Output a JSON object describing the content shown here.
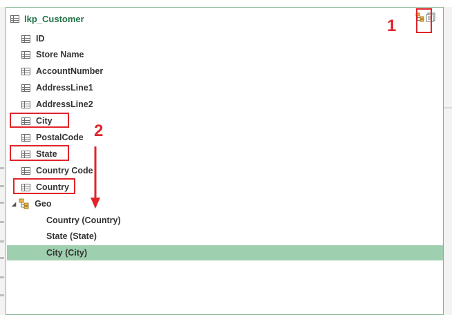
{
  "table": {
    "title": "lkp_Customer",
    "fields": [
      {
        "label": "ID"
      },
      {
        "label": "Store Name"
      },
      {
        "label": "AccountNumber"
      },
      {
        "label": "AddressLine1"
      },
      {
        "label": "AddressLine2"
      },
      {
        "label": "City"
      },
      {
        "label": "PostalCode"
      },
      {
        "label": "State"
      },
      {
        "label": "Country Code"
      },
      {
        "label": "Country"
      }
    ],
    "hierarchy": {
      "label": "Geo",
      "levels": [
        {
          "label": "Country (Country)"
        },
        {
          "label": "State (State)"
        },
        {
          "label": "City (City)",
          "selected": true
        }
      ]
    }
  },
  "annotations": {
    "callout_1": "1",
    "callout_2": "2",
    "color": "#e0242a"
  },
  "colors": {
    "title_green": "#217346",
    "selection_green": "#9ecfae",
    "border_green": "#7bb08a"
  },
  "icons": {
    "table": "table-icon",
    "hierarchy": "hierarchy-icon",
    "create_hierarchy": "create-hierarchy-icon",
    "more": "field-list-icon",
    "expand": "expand-triangle-icon"
  }
}
